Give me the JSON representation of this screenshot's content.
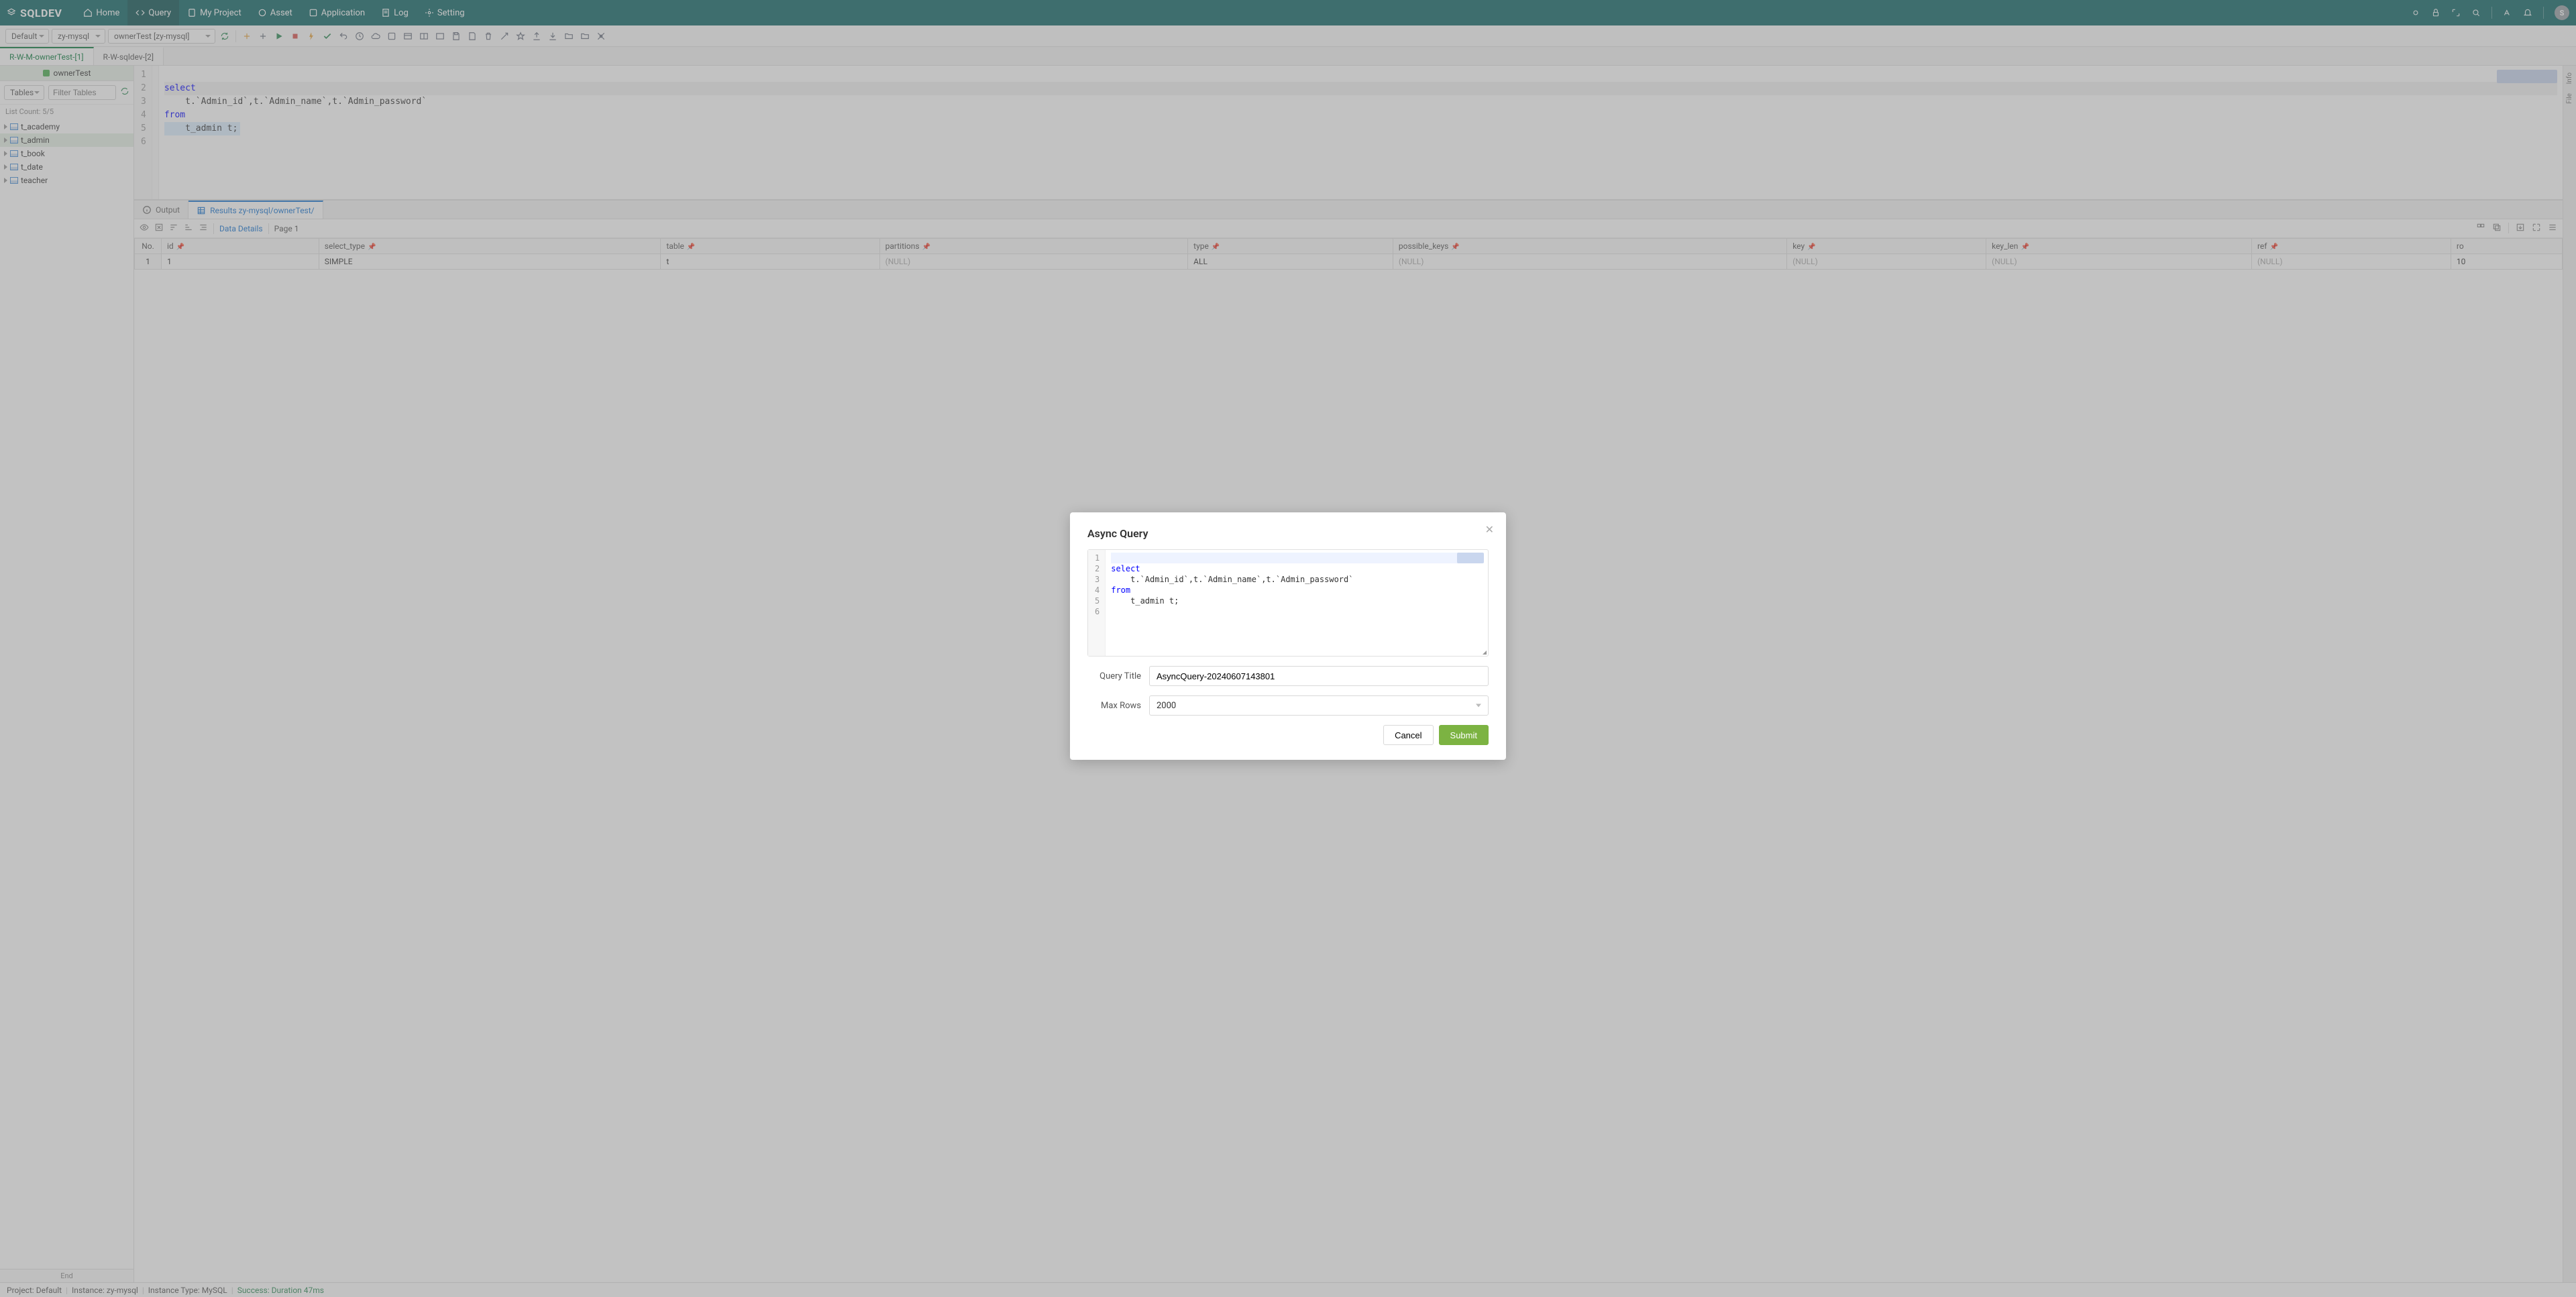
{
  "brand": "SQLDEV",
  "nav": {
    "home": "Home",
    "query": "Query",
    "project": "My Project",
    "asset": "Asset",
    "application": "Application",
    "log": "Log",
    "setting": "Setting"
  },
  "avatar_initial": "S",
  "toolbar": {
    "scope": "Default",
    "conn": "zy-mysql",
    "db": "ownerTest [zy-mysql]"
  },
  "editor_tabs": {
    "t1": "R-W-M-ownerTest-[1]",
    "t2": "R-W-sqldev-[2]"
  },
  "sidebar": {
    "db_name": "ownerTest",
    "object_type": "Tables",
    "filter_placeholder": "Filter Tables",
    "list_count_label": "List Count:",
    "list_count_value": "5/5",
    "tables": [
      "t_academy",
      "t_admin",
      "t_book",
      "t_date",
      "teacher"
    ],
    "end_label": "End"
  },
  "editor": {
    "lines": [
      "",
      "select",
      "    t.`Admin_id`,t.`Admin_name`,t.`Admin_password`",
      "from",
      "    t_admin t;",
      ""
    ],
    "keywords": [
      "select",
      "from"
    ]
  },
  "results": {
    "tab_output": "Output",
    "tab_results_prefix": "Results zy-mysql/ownerTest/",
    "data_details": "Data Details",
    "page_label": "Page",
    "page_value": "1",
    "columns": [
      "No.",
      "id",
      "select_type",
      "table",
      "partitions",
      "type",
      "possible_keys",
      "key",
      "key_len",
      "ref",
      "ro"
    ],
    "row": {
      "no": "1",
      "id": "1",
      "select_type": "SIMPLE",
      "table": "t",
      "partitions": "(NULL)",
      "type": "ALL",
      "possible_keys": "(NULL)",
      "key": "(NULL)",
      "key_len": "(NULL)",
      "ref": "(NULL)",
      "ro": "10"
    }
  },
  "right_rail": {
    "info": "Info",
    "file": "File"
  },
  "statusbar": {
    "project_label": "Project:",
    "project_value": "Default",
    "instance_label": "Instance:",
    "instance_value": "zy-mysql",
    "instance_type_label": "Instance Type:",
    "instance_type_value": "MySQL",
    "success_label": "Success:",
    "duration_label": "Duration 47ms"
  },
  "modal": {
    "title": "Async Query",
    "lines": [
      "",
      "select",
      "    t.`Admin_id`,t.`Admin_name`,t.`Admin_password`",
      "from",
      "    t_admin t;",
      ""
    ],
    "query_title_label": "Query Title",
    "query_title_value": "AsyncQuery-20240607143801",
    "max_rows_label": "Max Rows",
    "max_rows_value": "2000",
    "cancel": "Cancel",
    "submit": "Submit"
  }
}
